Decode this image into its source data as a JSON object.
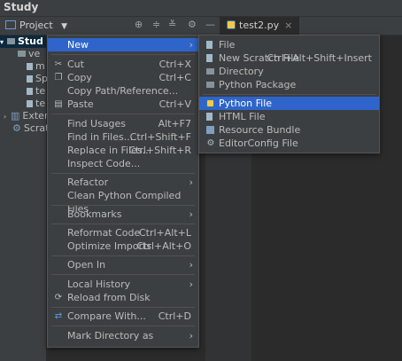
{
  "window": {
    "title": "Study"
  },
  "toolbar": {
    "project_label": "Project",
    "tab": {
      "label": "test2.py",
      "close": "×"
    }
  },
  "tree": {
    "items": [
      {
        "label": "Stud",
        "selected": true
      },
      {
        "label": "ve"
      },
      {
        "label": "m"
      },
      {
        "label": "Sp"
      },
      {
        "label": "te"
      },
      {
        "label": "te"
      },
      {
        "label": "Exter"
      },
      {
        "label": "Scrat"
      }
    ]
  },
  "context_menu": {
    "items": [
      {
        "label": "New",
        "highlight": true,
        "submenu": true
      },
      {
        "label": "Cut",
        "shortcut": "Ctrl+X",
        "icon": "scissors-icon"
      },
      {
        "label": "Copy",
        "shortcut": "Ctrl+C",
        "icon": "copy-icon"
      },
      {
        "label": "Copy Path/Reference..."
      },
      {
        "label": "Paste",
        "shortcut": "Ctrl+V",
        "icon": "paste-icon"
      },
      {
        "label": "Find Usages",
        "shortcut": "Alt+F7"
      },
      {
        "label": "Find in Files...",
        "shortcut": "Ctrl+Shift+F"
      },
      {
        "label": "Replace in Files...",
        "shortcut": "Ctrl+Shift+R"
      },
      {
        "label": "Inspect Code..."
      },
      {
        "label": "Refactor",
        "submenu": true
      },
      {
        "label": "Clean Python Compiled Files"
      },
      {
        "label": "Bookmarks",
        "submenu": true
      },
      {
        "label": "Reformat Code",
        "shortcut": "Ctrl+Alt+L"
      },
      {
        "label": "Optimize Imports",
        "shortcut": "Ctrl+Alt+O"
      },
      {
        "label": "Open In",
        "submenu": true
      },
      {
        "label": "Local History",
        "submenu": true
      },
      {
        "label": "Reload from Disk",
        "icon": "reload-icon"
      },
      {
        "label": "Compare With...",
        "shortcut": "Ctrl+D",
        "icon": "compare-icon"
      },
      {
        "label": "Mark Directory as",
        "submenu": true
      }
    ]
  },
  "new_submenu": {
    "items": [
      {
        "label": "File"
      },
      {
        "label": "New Scratch File",
        "shortcut": "Ctrl+Alt+Shift+Insert"
      },
      {
        "label": "Directory"
      },
      {
        "label": "Python Package"
      },
      {
        "label": "Python File",
        "highlight": true
      },
      {
        "label": "HTML File"
      },
      {
        "label": "Resource Bundle"
      },
      {
        "label": "EditorConfig File"
      }
    ]
  },
  "colors": {
    "highlight": "#2f65ca",
    "menu_bg": "#3c3f41",
    "editor_bg": "#2b2b2b"
  }
}
